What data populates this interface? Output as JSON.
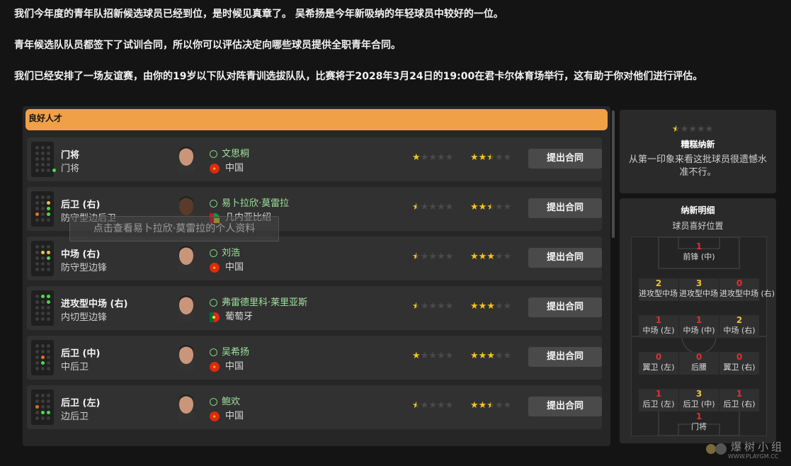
{
  "intro": {
    "line1": "我们今年度的青年队招新候选球员已经到位，是时候见真章了。 吴希扬是今年新吸纳的年轻球员中较好的一位。",
    "line2": "青年候选队队员都签下了试训合同，所以你可以评估决定向哪些球员提供全职青年合同。",
    "line3": "我们已经安排了一场友谊赛，由你的19岁以下队对阵青训选拔队队，比赛将于2028年3月24日的19:00在君卡尔体育场举行，这有助于你对他们进行评估。"
  },
  "section": {
    "title": "良好人才"
  },
  "tooltip": "点击查看易卜拉欣·莫雷拉的个人资料",
  "players": [
    {
      "position": "门将",
      "role": "门将",
      "name": "文思桐",
      "nation": "中国",
      "flag": "china",
      "ability": 1,
      "potential": 2.5,
      "button": "提出合同"
    },
    {
      "position": "后卫 (右)",
      "role": "防守型边后卫",
      "name": "易卜拉欣·莫雷拉",
      "nation": "几内亚比绍",
      "flag": "guinea-bissau",
      "ability": 0.5,
      "potential": 2.5,
      "button": "提出合同"
    },
    {
      "position": "中场 (右)",
      "role": "防守型边锋",
      "name": "刘浩",
      "nation": "中国",
      "flag": "china",
      "ability": 0.5,
      "potential": 3,
      "button": "提出合同"
    },
    {
      "position": "进攻型中场 (右)",
      "role": "内切型边锋",
      "name": "弗雷德里科·莱里亚斯",
      "nation": "葡萄牙",
      "flag": "portugal",
      "ability": 0.5,
      "potential": 3,
      "button": "提出合同"
    },
    {
      "position": "后卫 (中)",
      "role": "中后卫",
      "name": "吴希扬",
      "nation": "中国",
      "flag": "china",
      "ability": 1,
      "potential": 3,
      "button": "提出合同"
    },
    {
      "position": "后卫 (左)",
      "role": "边后卫",
      "name": "鲍欢",
      "nation": "中国",
      "flag": "china",
      "ability": 0.5,
      "potential": 2.5,
      "button": "提出合同"
    }
  ],
  "summary": {
    "rating": 0.5,
    "title": "糟糕纳新",
    "desc": "从第一印象来看这批球员很遗憾水准不行。"
  },
  "details": {
    "title": "纳新明细",
    "subtitle": "球员喜好位置",
    "cells": [
      {
        "count": "1",
        "label": "前锋 (中)",
        "color": "#e03030"
      },
      {
        "count": "2",
        "label": "进攻型中场 (左)",
        "color": "#f0c040"
      },
      {
        "count": "3",
        "label": "进攻型中场 (中)",
        "color": "#f0c040"
      },
      {
        "count": "0",
        "label": "进攻型中场 (右)",
        "color": "#e03030"
      },
      {
        "count": "1",
        "label": "中场 (左)",
        "color": "#e03030"
      },
      {
        "count": "1",
        "label": "中场 (中)",
        "color": "#e03030"
      },
      {
        "count": "2",
        "label": "中场 (右)",
        "color": "#f0c040"
      },
      {
        "count": "0",
        "label": "翼卫 (左)",
        "color": "#e03030"
      },
      {
        "count": "0",
        "label": "后腰",
        "color": "#e03030"
      },
      {
        "count": "0",
        "label": "翼卫 (右)",
        "color": "#e03030"
      },
      {
        "count": "1",
        "label": "后卫 (左)",
        "color": "#e03030"
      },
      {
        "count": "3",
        "label": "后卫 (中)",
        "color": "#f0c040"
      },
      {
        "count": "1",
        "label": "后卫 (右)",
        "color": "#e03030"
      },
      {
        "count": "1",
        "label": "门将",
        "color": "#e03030"
      }
    ]
  },
  "watermark": {
    "title": "爆树小组",
    "url": "WWW.PLAYGM.CC"
  },
  "colors": {
    "accent": "#f0a047",
    "star": "#f5c518",
    "star_empty": "#4a4a4a",
    "player_name": "#9fe39f"
  }
}
